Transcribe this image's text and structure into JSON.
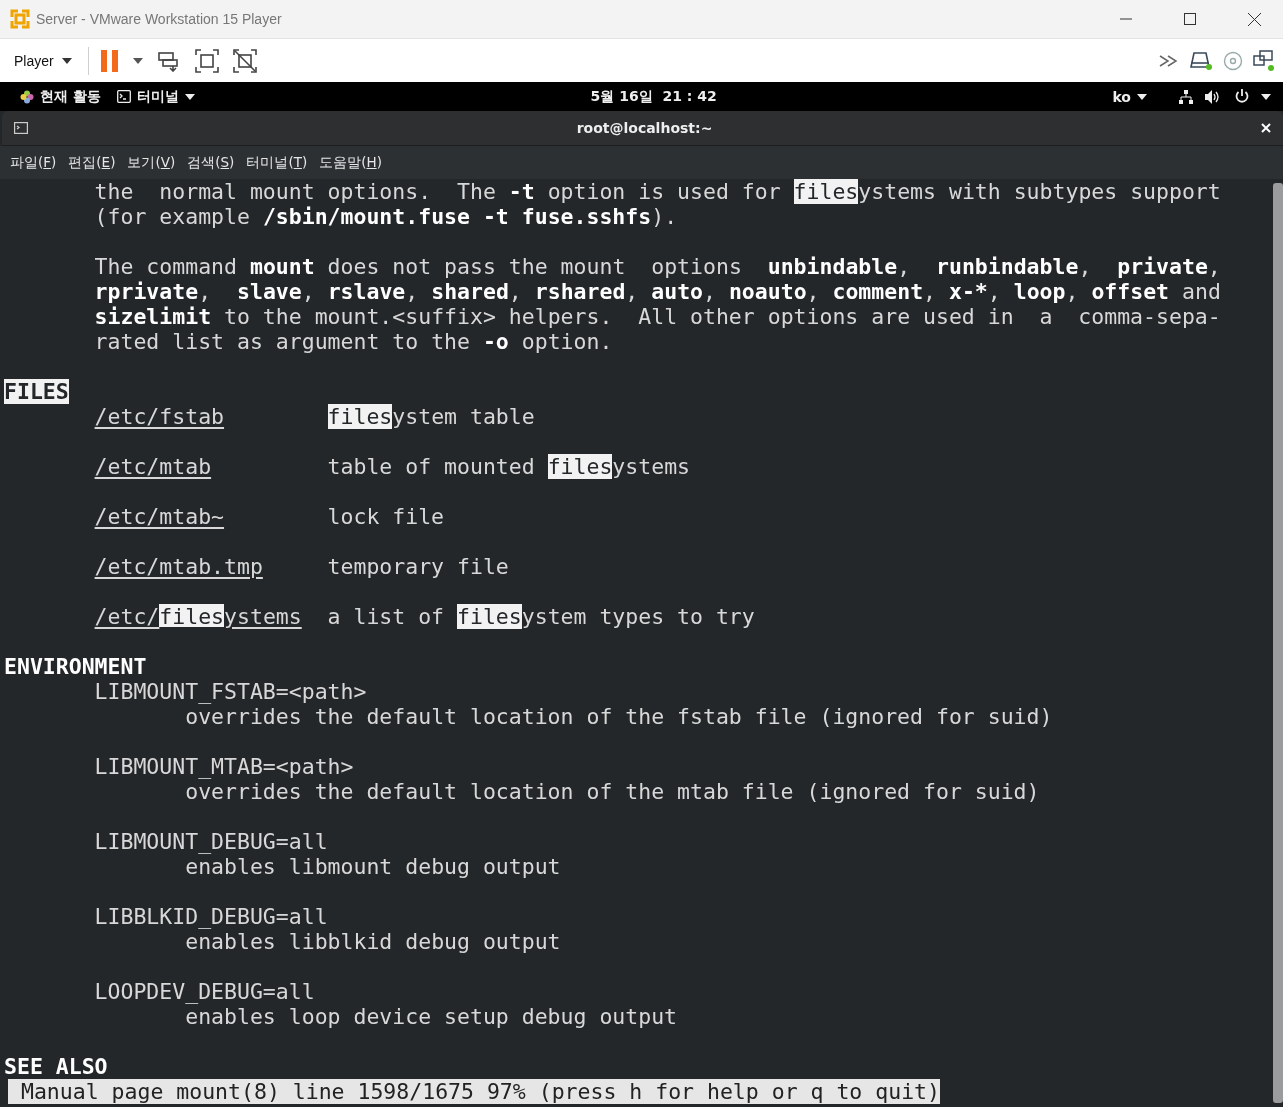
{
  "window": {
    "title": "Server - VMware Workstation 15 Player"
  },
  "toolbar": {
    "player_menu": "Player"
  },
  "top_bar": {
    "activities": "현재 활동",
    "app_menu": "터미널",
    "clock": "5월 16일  21 : 42",
    "input_method": "ko"
  },
  "terminal": {
    "title": "root@localhost:~",
    "menu": [
      "파일(F)",
      "편집(E)",
      "보기(V)",
      "검색(S)",
      "터미널(T)",
      "도움말(H)"
    ],
    "lines": [
      {
        "kind": "text",
        "segments": [
          {
            "kind": "plain",
            "text": "the  normal mount options.  The "
          },
          {
            "kind": "bold",
            "text": "-t"
          },
          {
            "kind": "plain",
            "text": " option is used for "
          },
          {
            "kind": "match",
            "text": "files"
          },
          {
            "kind": "plain",
            "text": "ystems with subtypes support"
          }
        ]
      },
      {
        "kind": "text",
        "segments": [
          {
            "kind": "plain",
            "text": "(for example "
          },
          {
            "kind": "bold",
            "text": "/sbin/mount.fuse -t fuse.sshfs"
          },
          {
            "kind": "plain",
            "text": ")."
          }
        ]
      },
      {
        "kind": "blank"
      },
      {
        "kind": "text",
        "segments": [
          {
            "kind": "plain",
            "text": "The command "
          },
          {
            "kind": "bold",
            "text": "mount"
          },
          {
            "kind": "plain",
            "text": " does not pass the mount  options  "
          },
          {
            "kind": "bold",
            "text": "unbindable"
          },
          {
            "kind": "plain",
            "text": ",  "
          },
          {
            "kind": "bold",
            "text": "runbindable"
          },
          {
            "kind": "plain",
            "text": ",  "
          },
          {
            "kind": "bold",
            "text": "private"
          },
          {
            "kind": "plain",
            "text": ","
          }
        ]
      },
      {
        "kind": "text",
        "segments": [
          {
            "kind": "bold",
            "text": "rprivate"
          },
          {
            "kind": "plain",
            "text": ",  "
          },
          {
            "kind": "bold",
            "text": "slave"
          },
          {
            "kind": "plain",
            "text": ", "
          },
          {
            "kind": "bold",
            "text": "rslave"
          },
          {
            "kind": "plain",
            "text": ", "
          },
          {
            "kind": "bold",
            "text": "shared"
          },
          {
            "kind": "plain",
            "text": ", "
          },
          {
            "kind": "bold",
            "text": "rshared"
          },
          {
            "kind": "plain",
            "text": ", "
          },
          {
            "kind": "bold",
            "text": "auto"
          },
          {
            "kind": "plain",
            "text": ", "
          },
          {
            "kind": "bold",
            "text": "noauto"
          },
          {
            "kind": "plain",
            "text": ", "
          },
          {
            "kind": "bold",
            "text": "comment"
          },
          {
            "kind": "plain",
            "text": ", "
          },
          {
            "kind": "bold",
            "text": "x-*"
          },
          {
            "kind": "plain",
            "text": ", "
          },
          {
            "kind": "bold",
            "text": "loop"
          },
          {
            "kind": "plain",
            "text": ", "
          },
          {
            "kind": "bold",
            "text": "offset"
          },
          {
            "kind": "plain",
            "text": " and"
          }
        ]
      },
      {
        "kind": "text",
        "segments": [
          {
            "kind": "bold",
            "text": "sizelimit"
          },
          {
            "kind": "plain",
            "text": " to the mount.<suffix> helpers.  All other options are used in  a  comma-sepa‐"
          }
        ]
      },
      {
        "kind": "text",
        "segments": [
          {
            "kind": "plain",
            "text": "rated list as argument to the "
          },
          {
            "kind": "bold",
            "text": "-o"
          },
          {
            "kind": "plain",
            "text": " option."
          }
        ]
      },
      {
        "kind": "blank"
      },
      {
        "kind": "section",
        "segments": [
          {
            "kind": "bold-match",
            "text": "FILES"
          }
        ]
      },
      {
        "kind": "entry",
        "path": [
          {
            "kind": "underline",
            "text": "/etc/fstab"
          }
        ],
        "description": [
          {
            "kind": "match",
            "text": "files"
          },
          {
            "kind": "plain",
            "text": "ystem table"
          }
        ]
      },
      {
        "kind": "blank"
      },
      {
        "kind": "entry",
        "path": [
          {
            "kind": "underline",
            "text": "/etc/mtab"
          }
        ],
        "description": [
          {
            "kind": "plain",
            "text": "table of mounted "
          },
          {
            "kind": "match",
            "text": "files"
          },
          {
            "kind": "plain",
            "text": "ystems"
          }
        ]
      },
      {
        "kind": "blank"
      },
      {
        "kind": "entry",
        "path": [
          {
            "kind": "underline",
            "text": "/etc/mtab~"
          }
        ],
        "description": [
          {
            "kind": "plain",
            "text": "lock file"
          }
        ]
      },
      {
        "kind": "blank"
      },
      {
        "kind": "entry",
        "path": [
          {
            "kind": "underline",
            "text": "/etc/mtab.tmp"
          }
        ],
        "description": [
          {
            "kind": "plain",
            "text": "temporary file"
          }
        ]
      },
      {
        "kind": "blank"
      },
      {
        "kind": "entry",
        "path": [
          {
            "kind": "underline",
            "text": "/etc/"
          },
          {
            "kind": "underline-match",
            "text": "files"
          },
          {
            "kind": "underline",
            "text": "ystems"
          }
        ],
        "description": [
          {
            "kind": "plain",
            "text": "a list of "
          },
          {
            "kind": "match",
            "text": "files"
          },
          {
            "kind": "plain",
            "text": "ystem types to try"
          }
        ]
      },
      {
        "kind": "blank"
      },
      {
        "kind": "section",
        "segments": [
          {
            "kind": "bold",
            "text": "ENVIRONMENT"
          }
        ]
      },
      {
        "kind": "text",
        "segments": [
          {
            "kind": "plain",
            "text": "LIBMOUNT_FSTAB=<path>"
          }
        ]
      },
      {
        "kind": "subtext",
        "segments": [
          {
            "kind": "plain",
            "text": "overrides the default location of the fstab file (ignored for suid)"
          }
        ]
      },
      {
        "kind": "blank"
      },
      {
        "kind": "text",
        "segments": [
          {
            "kind": "plain",
            "text": "LIBMOUNT_MTAB=<path>"
          }
        ]
      },
      {
        "kind": "subtext",
        "segments": [
          {
            "kind": "plain",
            "text": "overrides the default location of the mtab file (ignored for suid)"
          }
        ]
      },
      {
        "kind": "blank"
      },
      {
        "kind": "text",
        "segments": [
          {
            "kind": "plain",
            "text": "LIBMOUNT_DEBUG=all"
          }
        ]
      },
      {
        "kind": "subtext",
        "segments": [
          {
            "kind": "plain",
            "text": "enables libmount debug output"
          }
        ]
      },
      {
        "kind": "blank"
      },
      {
        "kind": "text",
        "segments": [
          {
            "kind": "plain",
            "text": "LIBBLKID_DEBUG=all"
          }
        ]
      },
      {
        "kind": "subtext",
        "segments": [
          {
            "kind": "plain",
            "text": "enables libblkid debug output"
          }
        ]
      },
      {
        "kind": "blank"
      },
      {
        "kind": "text",
        "segments": [
          {
            "kind": "plain",
            "text": "LOOPDEV_DEBUG=all"
          }
        ]
      },
      {
        "kind": "subtext",
        "segments": [
          {
            "kind": "plain",
            "text": "enables loop device setup debug output"
          }
        ]
      },
      {
        "kind": "blank"
      },
      {
        "kind": "section",
        "segments": [
          {
            "kind": "bold",
            "text": "SEE ALSO"
          }
        ]
      }
    ],
    "status": "Manual page mount(8) line 1598/1675 97% (press h for help or q to quit)"
  }
}
